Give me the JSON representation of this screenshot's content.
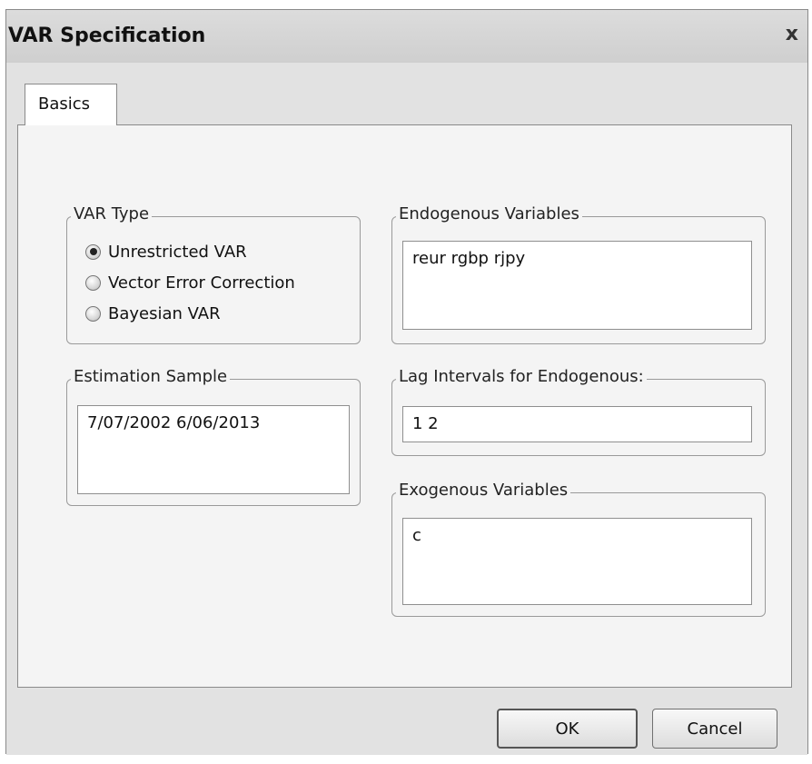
{
  "window": {
    "title": "VAR Specification",
    "close_glyph": "x"
  },
  "tabs": [
    {
      "label": "Basics",
      "active": true
    }
  ],
  "var_type": {
    "legend": "VAR Type",
    "options": [
      {
        "label": "Unrestricted VAR",
        "selected": true
      },
      {
        "label": "Vector Error Correction",
        "selected": false
      },
      {
        "label": "Bayesian VAR",
        "selected": false
      }
    ]
  },
  "estimation_sample": {
    "legend": "Estimation Sample",
    "value": "7/07/2002 6/06/2013"
  },
  "endogenous": {
    "legend": "Endogenous Variables",
    "value": "reur rgbp rjpy"
  },
  "lag_intervals": {
    "legend": "Lag Intervals for Endogenous:",
    "value": "1 2"
  },
  "exogenous": {
    "legend": "Exogenous Variables",
    "value": "c"
  },
  "buttons": {
    "ok": "OK",
    "cancel": "Cancel"
  }
}
